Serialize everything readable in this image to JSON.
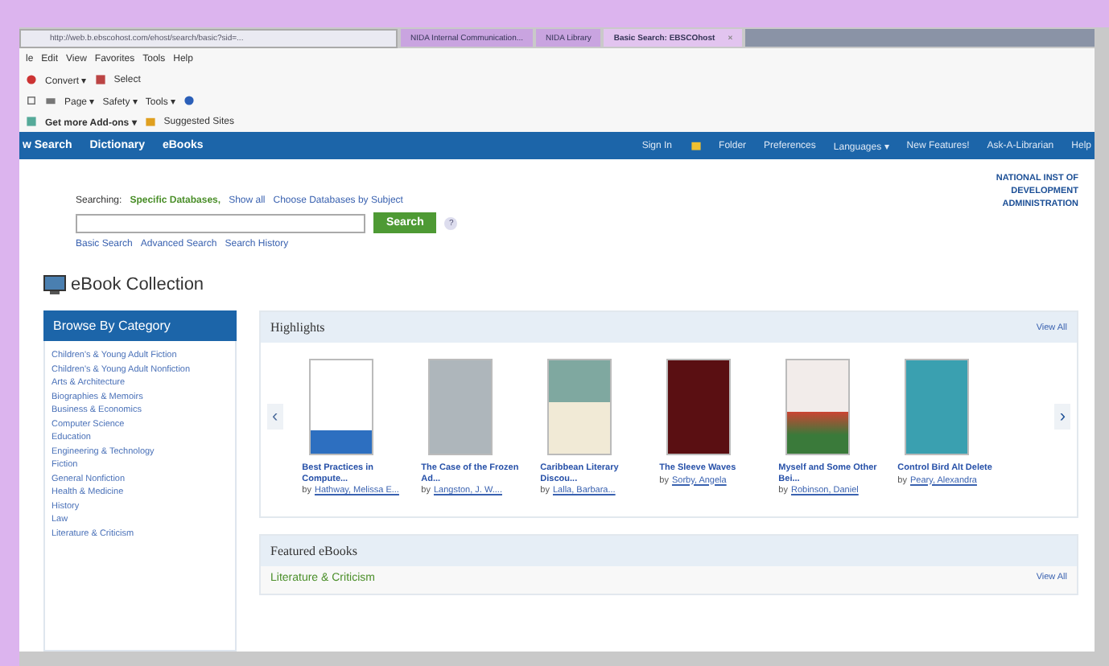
{
  "browser": {
    "address": "http://web.b.ebscohost.com/ehost/search/basic?sid=...",
    "tabs": [
      {
        "label": "NIDA Internal Communication...",
        "selected": false,
        "color": "#c9a4e0"
      },
      {
        "label": "NIDA Library",
        "selected": false,
        "color": "#c9a4e0"
      },
      {
        "label": "Basic Search: EBSCOhost",
        "selected": true,
        "color": "#e2c4ef"
      }
    ],
    "tab_close": "×",
    "menu": [
      "le",
      "Edit",
      "View",
      "Favorites",
      "Tools",
      "Help"
    ],
    "toolbar": [
      "Convert ▾",
      "Select"
    ],
    "command_bar": [
      "Page ▾",
      "Safety ▾",
      "Tools ▾"
    ],
    "favorites_bar": [
      "Get more Add-ons ▾",
      "Suggested Sites"
    ]
  },
  "nav": {
    "left": [
      "w Search",
      "Dictionary",
      "eBooks"
    ],
    "right": [
      "Sign In",
      "Folder",
      "Preferences",
      "Languages ▾",
      "New Features!",
      "Ask-A-Librarian",
      "Help"
    ]
  },
  "search": {
    "searching_label": "Searching:",
    "databases": "Specific Databases,",
    "show_all": "Show all",
    "choose": "Choose Databases by Subject",
    "button": "Search",
    "help": "?",
    "links": [
      "Basic Search",
      "Advanced Search",
      "Search History"
    ]
  },
  "institution": [
    "NATIONAL INST OF",
    "DEVELOPMENT",
    "ADMINISTRATION"
  ],
  "page_title": "eBook Collection",
  "sidebar": {
    "title": "Browse By Category",
    "items": [
      "Children's & Young Adult Fiction",
      "Children's & Young Adult Nonfiction",
      "Arts & Architecture",
      "Biographies & Memoirs",
      "Business & Economics",
      "Computer Science",
      "Education",
      "Engineering & Technology",
      "Fiction",
      "General Nonfiction",
      "Health & Medicine",
      "History",
      "Law",
      "Literature & Criticism"
    ]
  },
  "highlights": {
    "title": "Highlights",
    "view_all": "View All",
    "prev": "‹",
    "next": "›",
    "books": [
      {
        "title": "Best Practices in Compute...",
        "by": "by",
        "author": "Hathway, Melissa E..."
      },
      {
        "title": "The Case of the Frozen Ad...",
        "by": "by",
        "author": "Langston, J. W...."
      },
      {
        "title": "Caribbean Literary Discou...",
        "by": "by",
        "author": "Lalla, Barbara..."
      },
      {
        "title": "The Sleeve Waves",
        "by": "by",
        "author": "Sorby, Angela"
      },
      {
        "title": "Myself and Some Other Bei...",
        "by": "by",
        "author": "Robinson, Daniel"
      },
      {
        "title": "Control Bird Alt Delete",
        "by": "by",
        "author": "Peary, Alexandra"
      }
    ]
  },
  "featured": {
    "title": "Featured eBooks",
    "category": "Literature & Criticism",
    "view_all": "View All"
  }
}
